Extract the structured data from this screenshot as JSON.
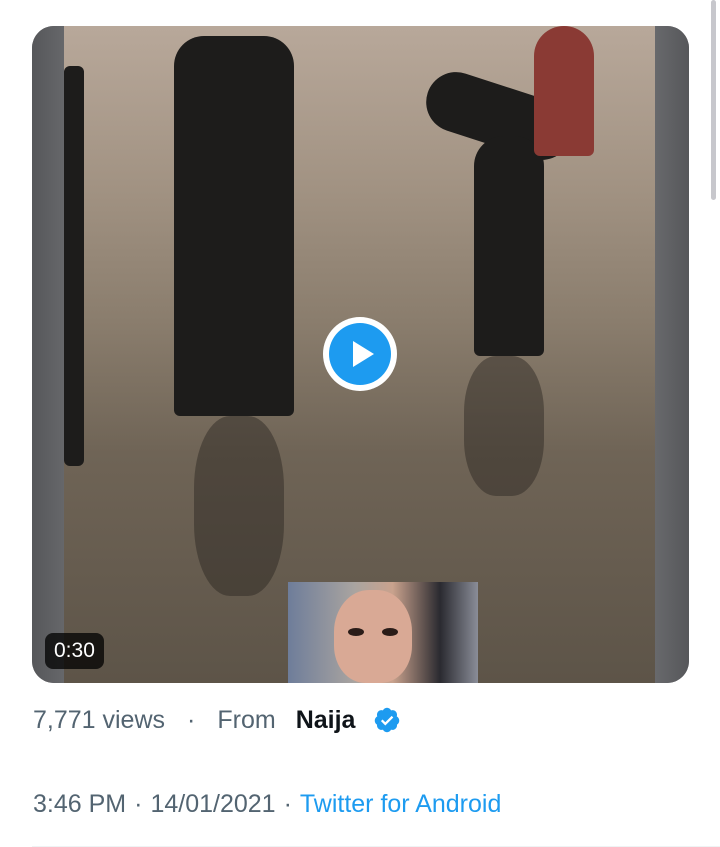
{
  "media": {
    "duration": "0:30",
    "play_icon": "play-icon"
  },
  "meta": {
    "views": "7,771 views",
    "separator": "·",
    "from_label": "From",
    "source_name": "Naija",
    "verified_icon": "verified-badge-icon"
  },
  "timestamp": {
    "time": "3:46 PM",
    "sep1": "·",
    "date": "14/01/2021",
    "sep2": "·",
    "client": "Twitter for Android"
  },
  "colors": {
    "accent": "#1d9bf0",
    "secondary_text": "#536471",
    "primary_text": "#0f1419"
  }
}
